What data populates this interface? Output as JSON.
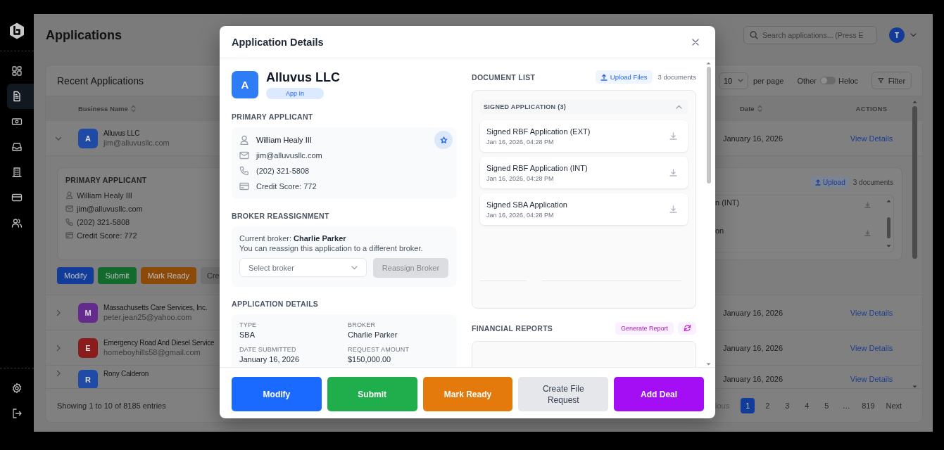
{
  "sidebar": {
    "items": [
      {
        "selected": false
      },
      {
        "selected": true
      },
      {
        "selected": false
      },
      {
        "selected": false
      },
      {
        "selected": false
      },
      {
        "selected": false
      },
      {
        "selected": false
      }
    ],
    "bottom_items": [
      {
        "selected": false
      },
      {
        "selected": false
      }
    ]
  },
  "header": {
    "title": "Applications",
    "search": {
      "placeholder": "Search applications... (Press E"
    },
    "user": {
      "initial": "T"
    }
  },
  "applications": {
    "title": "Recent Applications",
    "per_page": {
      "value": "10",
      "label": "per page"
    },
    "toggle": {
      "left_label": "Other",
      "right_label": "Heloc",
      "on": false
    },
    "filter": "Filter",
    "columns": [
      {
        "label": "Business Name"
      },
      {
        "label": "Date"
      },
      {
        "label": "ACTIONS"
      }
    ],
    "rows": [
      {
        "expanded": true,
        "initial": "A",
        "color": "#1f4aa6",
        "name": "Alluvus LLC",
        "email": "jim@alluvusllc.com",
        "date": "January 16, 2026",
        "action": "View Details",
        "details": {
          "heading": "PRIMARY APPLICANT",
          "applicant": [
            "William Healy III",
            "jim@alluvusllc.com",
            "(202) 321-5808",
            "Credit Score: 772"
          ],
          "upload": "Upload",
          "doc_count": "3 documents",
          "documents": [
            "n (INT)",
            "on"
          ],
          "buttons": [
            {
              "label": "Modify",
              "kind": "modify"
            },
            {
              "label": "Submit",
              "kind": "submit"
            },
            {
              "label": "Mark Ready",
              "kind": "ready"
            },
            {
              "label": "Cre",
              "kind": "request"
            }
          ]
        }
      },
      {
        "expanded": false,
        "initial": "M",
        "color": "#642a8e",
        "name": "Massachusetts Care Services, Inc.",
        "email": "peter.jean25@yahoo.com",
        "date": "January 16, 2026",
        "action": "View Details"
      },
      {
        "expanded": false,
        "initial": "E",
        "color": "#8a1c1c",
        "name": "Emergency Road And Diesel Service",
        "email": "homeboyhills58@gmail.com",
        "date": "January 16, 2026",
        "action": "View Details"
      },
      {
        "expanded": false,
        "initial": "R",
        "color": "#1f4aa5",
        "name": "Rony Calderon",
        "date": "January 16, 2026",
        "action": "View Details"
      }
    ],
    "pagination": {
      "summary": "Showing 1 to 10 of 8185 entries",
      "previous": "ious",
      "pages": [
        {
          "label": "1",
          "selected": true
        },
        {
          "label": "2",
          "selected": false
        },
        {
          "label": "3",
          "selected": false
        },
        {
          "label": "4",
          "selected": false
        },
        {
          "label": "5",
          "selected": false
        },
        {
          "label": "…",
          "selected": false
        },
        {
          "label": "819",
          "selected": false
        }
      ],
      "next": "Next"
    }
  },
  "modal": {
    "title": "Application Details",
    "business": {
      "initial": "A",
      "name": "Alluvus LLC",
      "status": "App In"
    },
    "primary_applicant": {
      "heading": "PRIMARY APPLICANT",
      "fields": [
        "William Healy III",
        "jim@alluvusllc.com",
        "(202) 321-5808",
        "Credit Score: 772"
      ]
    },
    "broker_reassignment": {
      "heading": "BROKER REASSIGNMENT",
      "current": "Current broker: **Charlie Parker**",
      "hint": "You can reassign this application to a different broker.",
      "select": {
        "placeholder": "Select broker"
      },
      "button": {
        "label": "Reassign Broker",
        "disabled": true
      }
    },
    "application_details": {
      "heading": "APPLICATION DETAILS",
      "fields": [
        {
          "label": "TYPE",
          "value": "SBA"
        },
        {
          "label": "BROKER",
          "value": "Charlie Parker"
        },
        {
          "label": "DATE SUBMITTED",
          "value": "January 16, 2026"
        },
        {
          "label": "REQUEST AMOUNT",
          "value": "$150,000.00"
        }
      ]
    },
    "document_list": {
      "heading": "DOCUMENT LIST",
      "upload": "Upload Files",
      "count": "3 documents",
      "groups": [
        {
          "title": "SIGNED APPLICATION (3)",
          "expanded": true,
          "documents": [
            {
              "name": "Signed RBF Application (EXT)",
              "date": "Jan 16, 2026, 04:28 PM"
            },
            {
              "name": "Signed RBF Application (INT)",
              "date": "Jan 16, 2026, 04:28 PM"
            },
            {
              "name": "Signed SBA Application",
              "date": "Jan 16, 2026, 04:28 PM"
            }
          ]
        }
      ]
    },
    "financial_reports": {
      "heading": "FINANCIAL REPORTS",
      "generate": "Generate Report"
    },
    "actions": [
      {
        "label": "Modify",
        "kind": "modify"
      },
      {
        "label": "Submit",
        "kind": "submit"
      },
      {
        "label": "Mark Ready",
        "kind": "ready"
      },
      {
        "label": "Create File Request",
        "kind": "request"
      },
      {
        "label": "Add Deal",
        "kind": "deal"
      }
    ]
  }
}
